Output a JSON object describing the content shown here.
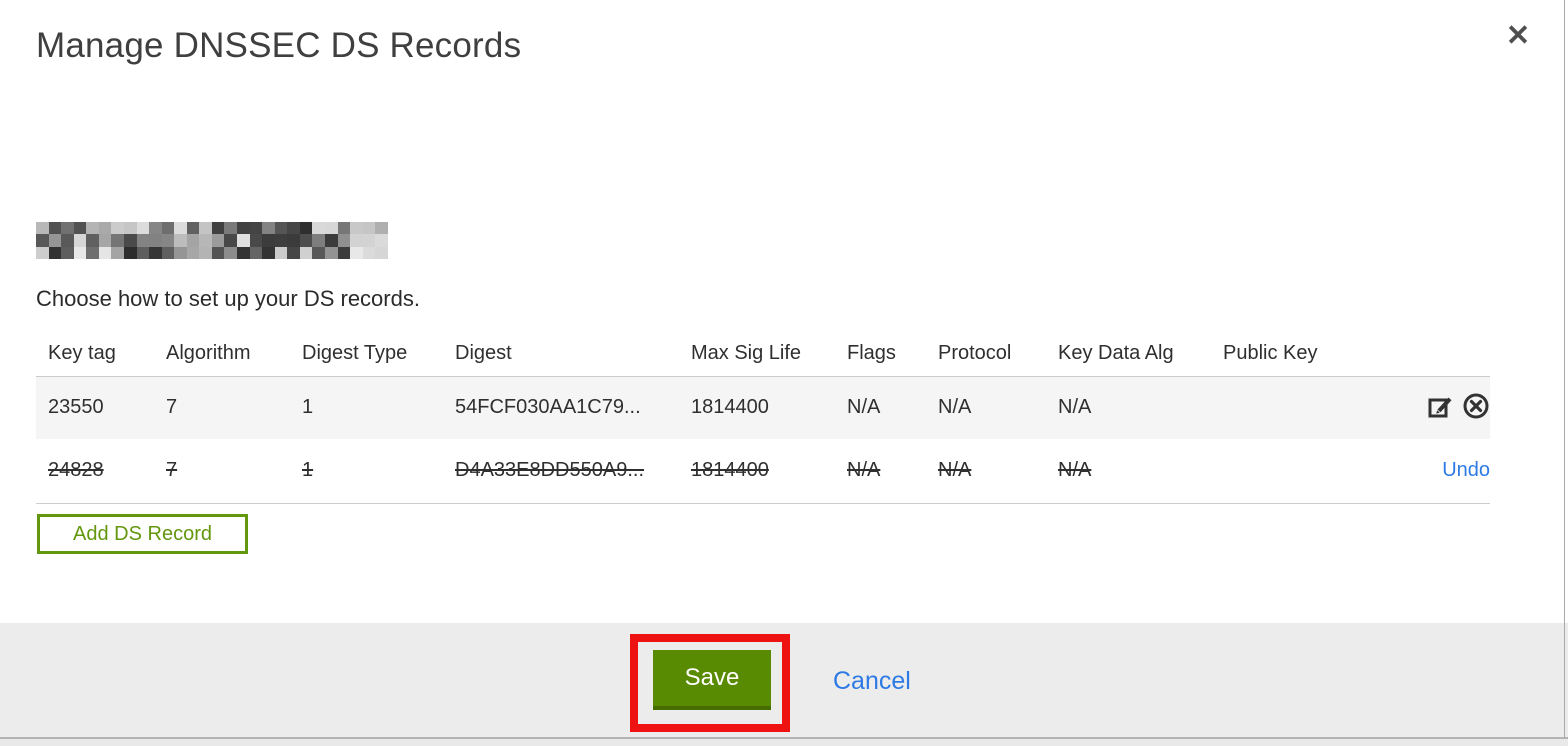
{
  "modal": {
    "title": "Manage DNSSEC DS Records",
    "close_glyph": "✕",
    "instruction": "Choose how to set up your DS records.",
    "table": {
      "columns": [
        "Key tag",
        "Algorithm",
        "Digest Type",
        "Digest",
        "Max Sig Life",
        "Flags",
        "Protocol",
        "Key Data Alg",
        "Public Key"
      ],
      "rows": [
        {
          "key_tag": "23550",
          "algorithm": "7",
          "digest_type": "1",
          "digest": "54FCF030AA1C79...",
          "max_sig_life": "1814400",
          "flags": "N/A",
          "protocol": "N/A",
          "key_data_alg": "N/A",
          "public_key": "",
          "state": "normal"
        },
        {
          "key_tag": "24828",
          "algorithm": "7",
          "digest_type": "1",
          "digest": "D4A33E8DD550A9...",
          "max_sig_life": "1814400",
          "flags": "N/A",
          "protocol": "N/A",
          "key_data_alg": "N/A",
          "public_key": "",
          "state": "deleted",
          "undo_label": "Undo"
        }
      ]
    },
    "add_button_label": "Add DS Record",
    "footer": {
      "save_label": "Save",
      "cancel_label": "Cancel"
    }
  },
  "colors": {
    "save_green": "#588a02",
    "save_green_dark": "#466d02",
    "add_button_green": "#63970e",
    "annotation_red": "#ee1212",
    "link_blue": "#2d7ae4",
    "footer_gray": "#ececec",
    "row_stripe_gray": "#f5f5f5"
  }
}
